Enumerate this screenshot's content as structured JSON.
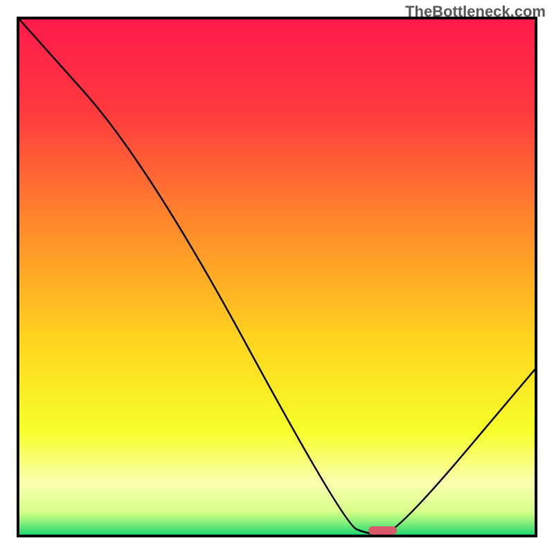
{
  "watermark": "TheBottleneck.com",
  "chart_data": {
    "type": "line",
    "title": "",
    "xlabel": "",
    "ylabel": "",
    "xlim": [
      0,
      100
    ],
    "ylim": [
      0,
      100
    ],
    "grid": false,
    "series": [
      {
        "name": "curve",
        "x": [
          0,
          25,
          63,
          68,
          73,
          100
        ],
        "y": [
          100,
          72,
          2,
          0,
          0,
          32
        ]
      }
    ],
    "marker": {
      "x_center": 70.5,
      "y": 0.8,
      "width_pct": 5.5,
      "height_pct": 1.6
    },
    "background_gradient_stops": [
      {
        "pos": 0.0,
        "color": "#ff1a4b"
      },
      {
        "pos": 0.18,
        "color": "#ff3a3f"
      },
      {
        "pos": 0.4,
        "color": "#ff8a2a"
      },
      {
        "pos": 0.62,
        "color": "#ffd41f"
      },
      {
        "pos": 0.8,
        "color": "#f6ff2a"
      },
      {
        "pos": 0.9,
        "color": "#fbffb0"
      },
      {
        "pos": 0.955,
        "color": "#d7ff8a"
      },
      {
        "pos": 0.975,
        "color": "#8ef07a"
      },
      {
        "pos": 1.0,
        "color": "#1fd873"
      }
    ]
  }
}
